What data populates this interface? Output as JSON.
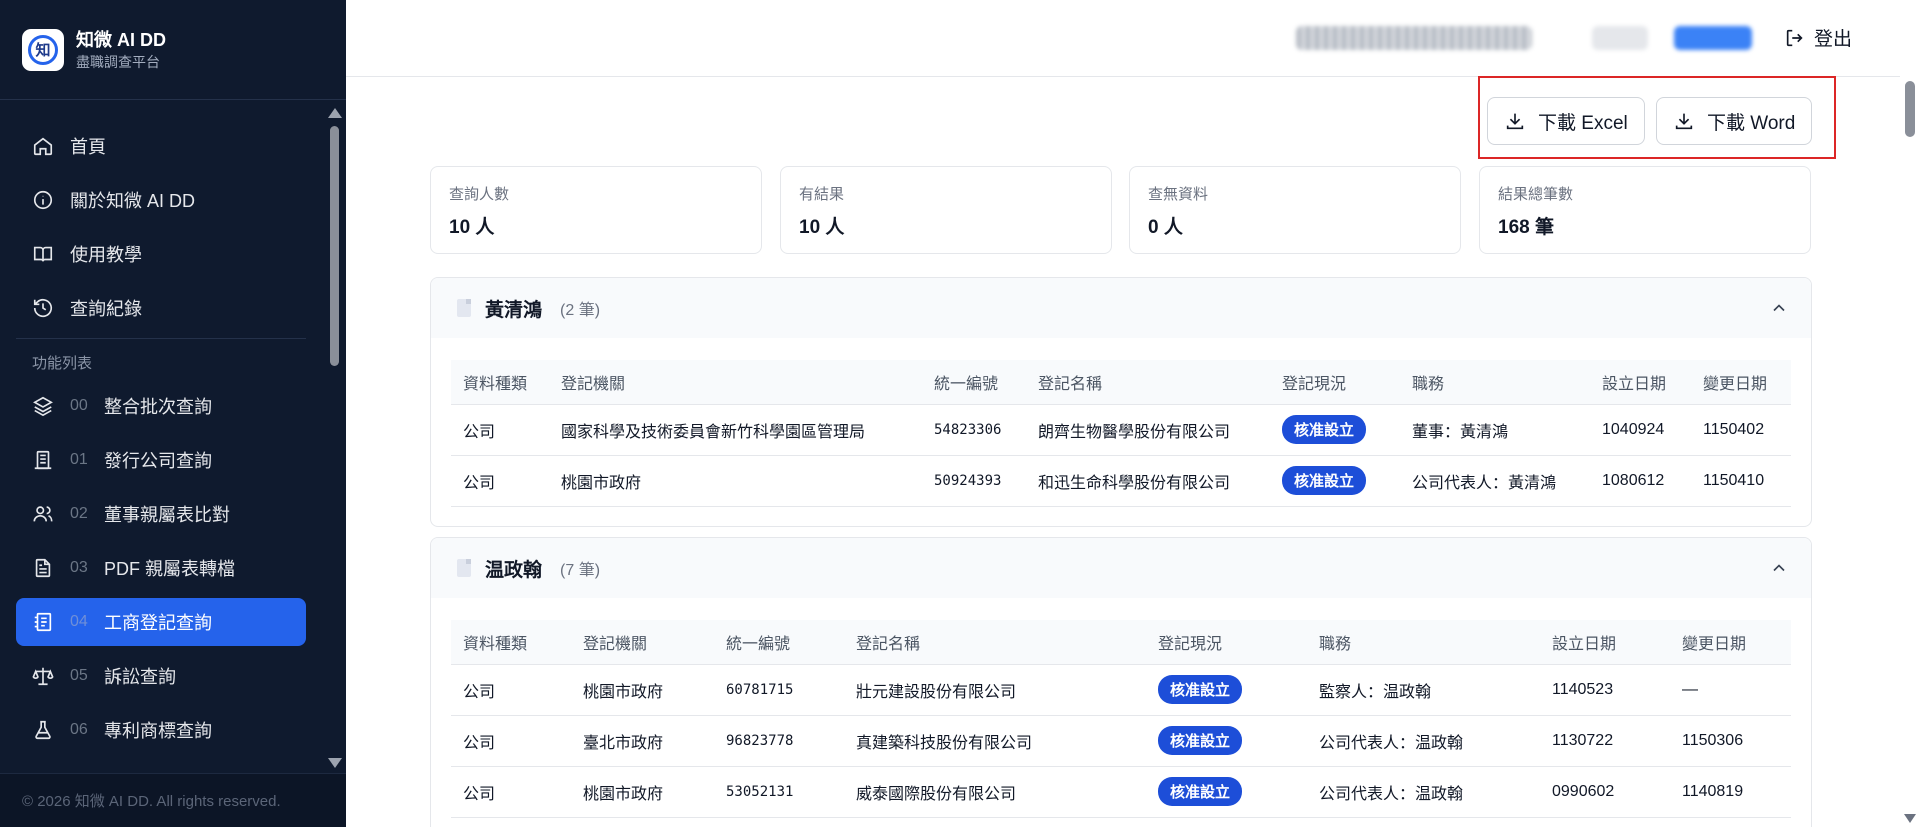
{
  "brand": {
    "logo_char": "知",
    "title": "知微 AI DD",
    "subtitle": "盡職調查平台"
  },
  "nav": {
    "home": "首頁",
    "about": "關於知微 AI DD",
    "tutorial": "使用教學",
    "history": "查詢紀錄",
    "section_label": "功能列表",
    "features": [
      {
        "num": "00",
        "label": "整合批次查詢",
        "icon": "layers-icon"
      },
      {
        "num": "01",
        "label": "發行公司查詢",
        "icon": "building-icon"
      },
      {
        "num": "02",
        "label": "董事親屬表比對",
        "icon": "users-icon"
      },
      {
        "num": "03",
        "label": "PDF 親屬表轉檔",
        "icon": "file-text-icon"
      },
      {
        "num": "04",
        "label": "工商登記查詢",
        "icon": "registry-icon",
        "active": true
      },
      {
        "num": "05",
        "label": "訴訟查詢",
        "icon": "scale-icon"
      },
      {
        "num": "06",
        "label": "專利商標查詢",
        "icon": "flask-icon"
      }
    ]
  },
  "footer": {
    "copyright": "© 2026 知微 AI DD. All rights reserved."
  },
  "topbar": {
    "logout_label": "登出"
  },
  "downloads": {
    "excel_label": "下載 Excel",
    "word_label": "下載 Word"
  },
  "stats": [
    {
      "label": "查詢人數",
      "value": "10 人"
    },
    {
      "label": "有結果",
      "value": "10 人"
    },
    {
      "label": "查無資料",
      "value": "0 人"
    },
    {
      "label": "結果總筆數",
      "value": "168 筆"
    }
  ],
  "table_headers": [
    "資料種類",
    "登記機關",
    "統一編號",
    "登記名稱",
    "登記現況",
    "職務",
    "設立日期",
    "變更日期"
  ],
  "cards": [
    {
      "name": "黃清鴻",
      "count": "(2 筆)",
      "rows": [
        [
          "公司",
          "國家科學及技術委員會新竹科學園區管理局",
          "54823306",
          "朗齊生物醫學股份有限公司",
          "核准設立",
          "董事：黃清鴻",
          "1040924",
          "1150402"
        ],
        [
          "公司",
          "桃園市政府",
          "50924393",
          "和迅生命科學股份有限公司",
          "核准設立",
          "公司代表人：黃清鴻",
          "1080612",
          "1150410"
        ]
      ]
    },
    {
      "name": "温政翰",
      "count": "(7 筆)",
      "rows": [
        [
          "公司",
          "桃園市政府",
          "60781715",
          "壯元建設股份有限公司",
          "核准設立",
          "監察人：温政翰",
          "1140523",
          "—"
        ],
        [
          "公司",
          "臺北市政府",
          "96823778",
          "真建築科技股份有限公司",
          "核准設立",
          "公司代表人：温政翰",
          "1130722",
          "1150306"
        ],
        [
          "公司",
          "桃園市政府",
          "53052131",
          "威泰國際股份有限公司",
          "核准設立",
          "公司代表人：温政翰",
          "0990602",
          "1140819"
        ]
      ]
    }
  ]
}
